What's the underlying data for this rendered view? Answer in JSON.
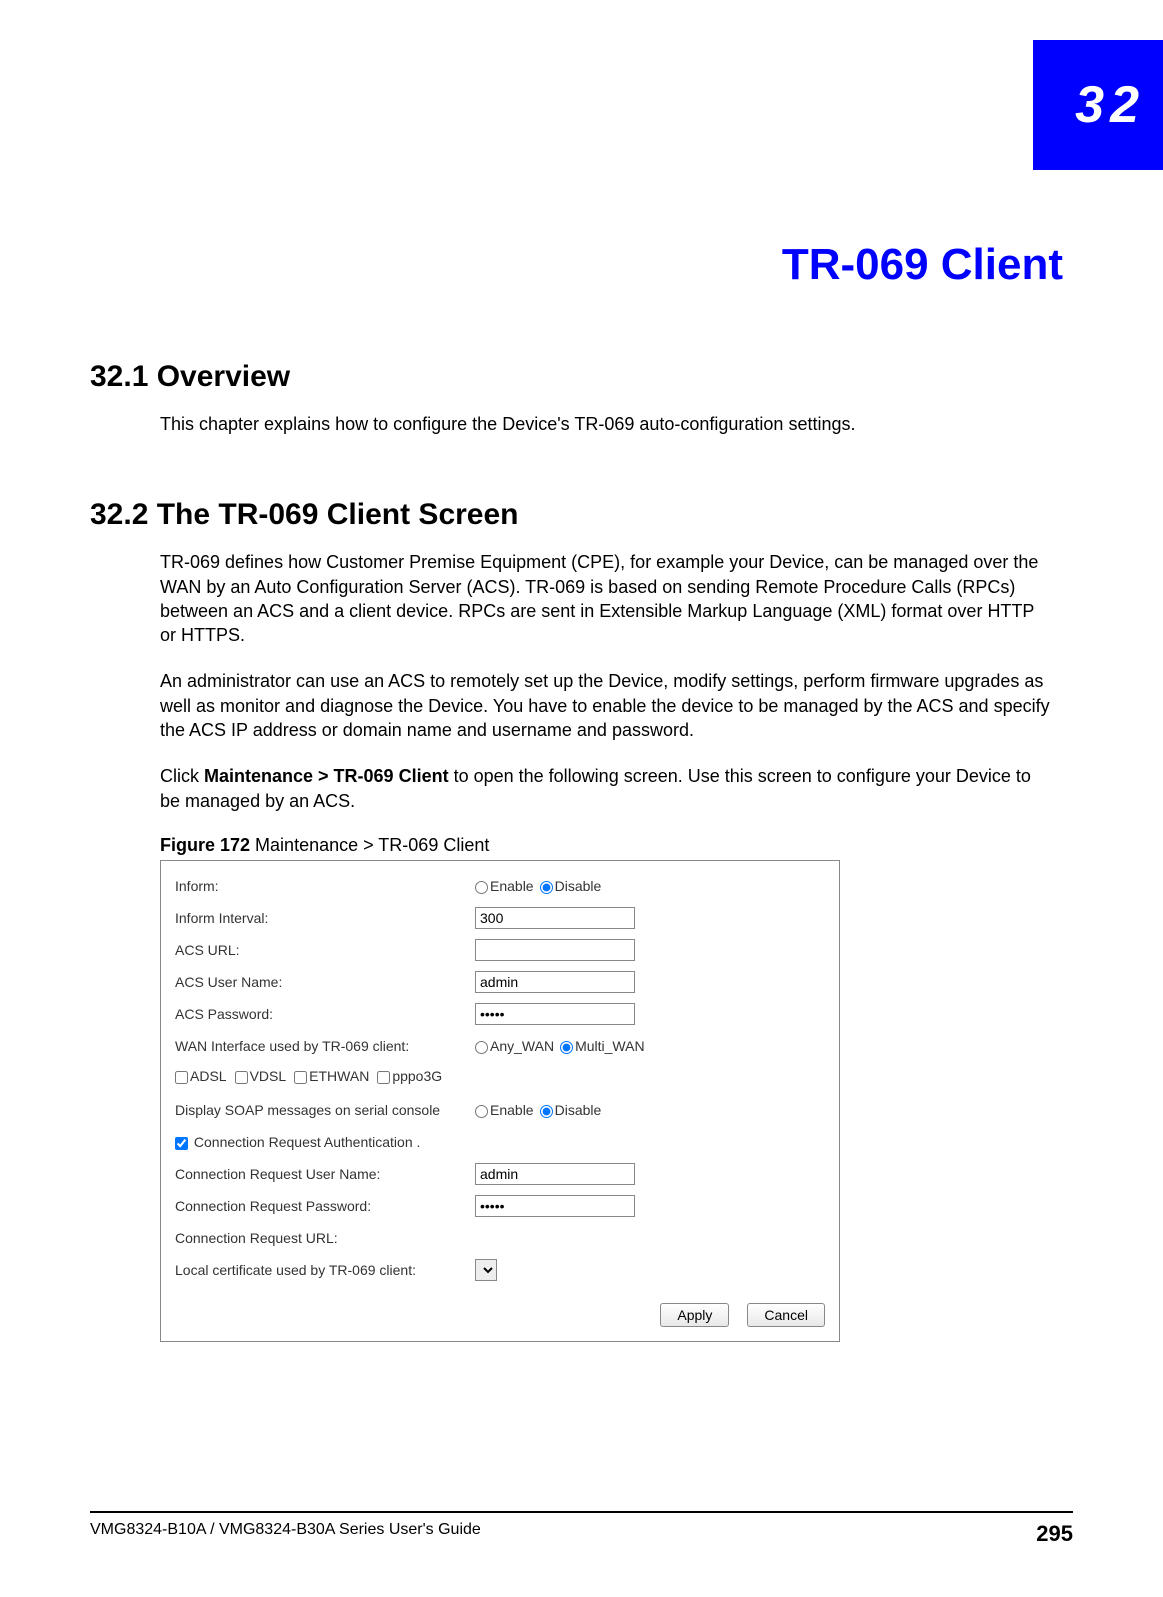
{
  "chapter": {
    "number": "32",
    "title": "TR-069 Client"
  },
  "sections": {
    "overview": {
      "heading": "32.1  Overview",
      "p1": "This chapter explains how to configure the Device's TR-069 auto-configuration settings."
    },
    "screen": {
      "heading": "32.2  The TR-069 Client Screen",
      "p1": "TR-069 defines how Customer Premise Equipment (CPE), for example your Device, can be managed over the WAN by an Auto Configuration Server (ACS). TR-069 is based on sending Remote Procedure Calls (RPCs) between an ACS and a client device. RPCs are sent in Extensible Markup Language (XML) format over HTTP or HTTPS.",
      "p2": "An administrator can use an ACS to remotely set up the Device, modify settings, perform firmware upgrades as well as monitor and diagnose the Device. You have to enable the device to be managed by the ACS and specify the ACS IP address or domain name and username and password.",
      "p3_pre": "Click ",
      "p3_bold": "Maintenance > TR-069 Client",
      "p3_post": " to open the following screen. Use this screen to configure your Device to be managed by an ACS.",
      "fig_label": "Figure 172",
      "fig_title": "   Maintenance > TR-069 Client"
    }
  },
  "figure": {
    "labels": {
      "inform": "Inform:",
      "inform_interval": "Inform Interval:",
      "acs_url": "ACS URL:",
      "acs_user": "ACS User Name:",
      "acs_pass": "ACS Password:",
      "wan_iface": "WAN Interface used by TR-069 client:",
      "soap": "Display SOAP messages on serial console",
      "conn_auth": "Connection Request Authentication .",
      "conn_user": "Connection Request User Name:",
      "conn_pass": "Connection Request Password:",
      "conn_url": "Connection Request URL:",
      "local_cert": "Local certificate used by TR-069 client:"
    },
    "radios": {
      "enable": "Enable",
      "disable": "Disable",
      "any_wan": "Any_WAN",
      "multi_wan": "Multi_WAN"
    },
    "checkboxes": {
      "adsl": "ADSL",
      "vdsl": "VDSL",
      "ethwan": "ETHWAN",
      "pppo3g": "pppo3G"
    },
    "values": {
      "inform_interval": "300",
      "acs_url": "",
      "acs_user": "admin",
      "acs_pass": "•••••",
      "conn_user": "admin",
      "conn_pass": "•••••",
      "conn_url": ""
    },
    "buttons": {
      "apply": "Apply",
      "cancel": "Cancel"
    }
  },
  "footer": {
    "guide": "VMG8324-B10A / VMG8324-B30A Series User's Guide",
    "page": "295"
  }
}
